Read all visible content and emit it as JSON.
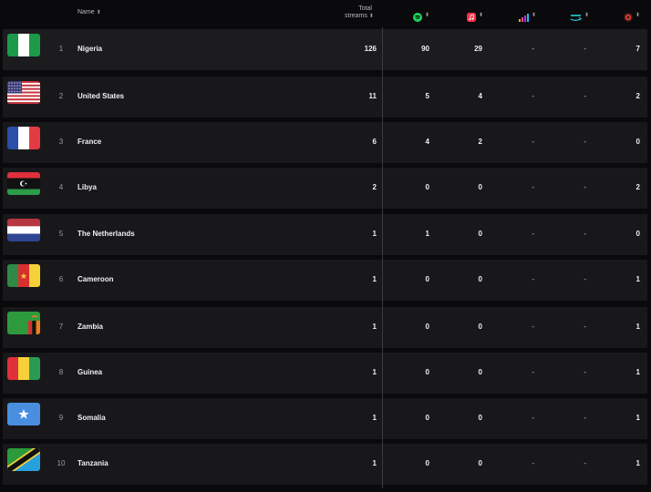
{
  "header": {
    "name_label": "Name",
    "total_label_line1": "Total",
    "total_label_line2": "streams",
    "sort_glyph": "⬍",
    "services": [
      {
        "icon": "spotify-icon",
        "color": "#1ed760"
      },
      {
        "icon": "apple-music-icon",
        "color": "#fa2d48"
      },
      {
        "icon": "deezer-icon",
        "color": "#a238ff"
      },
      {
        "icon": "amazon-music-icon",
        "color": "#25d1da"
      },
      {
        "icon": "audiomack-icon",
        "color": "#d33b2f"
      }
    ]
  },
  "rows": [
    {
      "rank": "1",
      "country": "Nigeria",
      "total": "126",
      "spotify": "90",
      "apple": "29",
      "deezer": "-",
      "amazon": "-",
      "other": "7",
      "flag": "nigeria"
    },
    {
      "rank": "2",
      "country": "United States",
      "total": "11",
      "spotify": "5",
      "apple": "4",
      "deezer": "-",
      "amazon": "-",
      "other": "2",
      "flag": "usa"
    },
    {
      "rank": "3",
      "country": "France",
      "total": "6",
      "spotify": "4",
      "apple": "2",
      "deezer": "-",
      "amazon": "-",
      "other": "0",
      "flag": "france"
    },
    {
      "rank": "4",
      "country": "Libya",
      "total": "2",
      "spotify": "0",
      "apple": "0",
      "deezer": "-",
      "amazon": "-",
      "other": "2",
      "flag": "libya"
    },
    {
      "rank": "5",
      "country": "The Netherlands",
      "total": "1",
      "spotify": "1",
      "apple": "0",
      "deezer": "-",
      "amazon": "-",
      "other": "0",
      "flag": "netherlands"
    },
    {
      "rank": "6",
      "country": "Cameroon",
      "total": "1",
      "spotify": "0",
      "apple": "0",
      "deezer": "-",
      "amazon": "-",
      "other": "1",
      "flag": "cameroon"
    },
    {
      "rank": "7",
      "country": "Zambia",
      "total": "1",
      "spotify": "0",
      "apple": "0",
      "deezer": "-",
      "amazon": "-",
      "other": "1",
      "flag": "zambia"
    },
    {
      "rank": "8",
      "country": "Guinea",
      "total": "1",
      "spotify": "0",
      "apple": "0",
      "deezer": "-",
      "amazon": "-",
      "other": "1",
      "flag": "guinea"
    },
    {
      "rank": "9",
      "country": "Somalia",
      "total": "1",
      "spotify": "0",
      "apple": "0",
      "deezer": "-",
      "amazon": "-",
      "other": "1",
      "flag": "somalia"
    },
    {
      "rank": "10",
      "country": "Tanzania",
      "total": "1",
      "spotify": "0",
      "apple": "0",
      "deezer": "-",
      "amazon": "-",
      "other": "1",
      "flag": "tanzania"
    }
  ]
}
